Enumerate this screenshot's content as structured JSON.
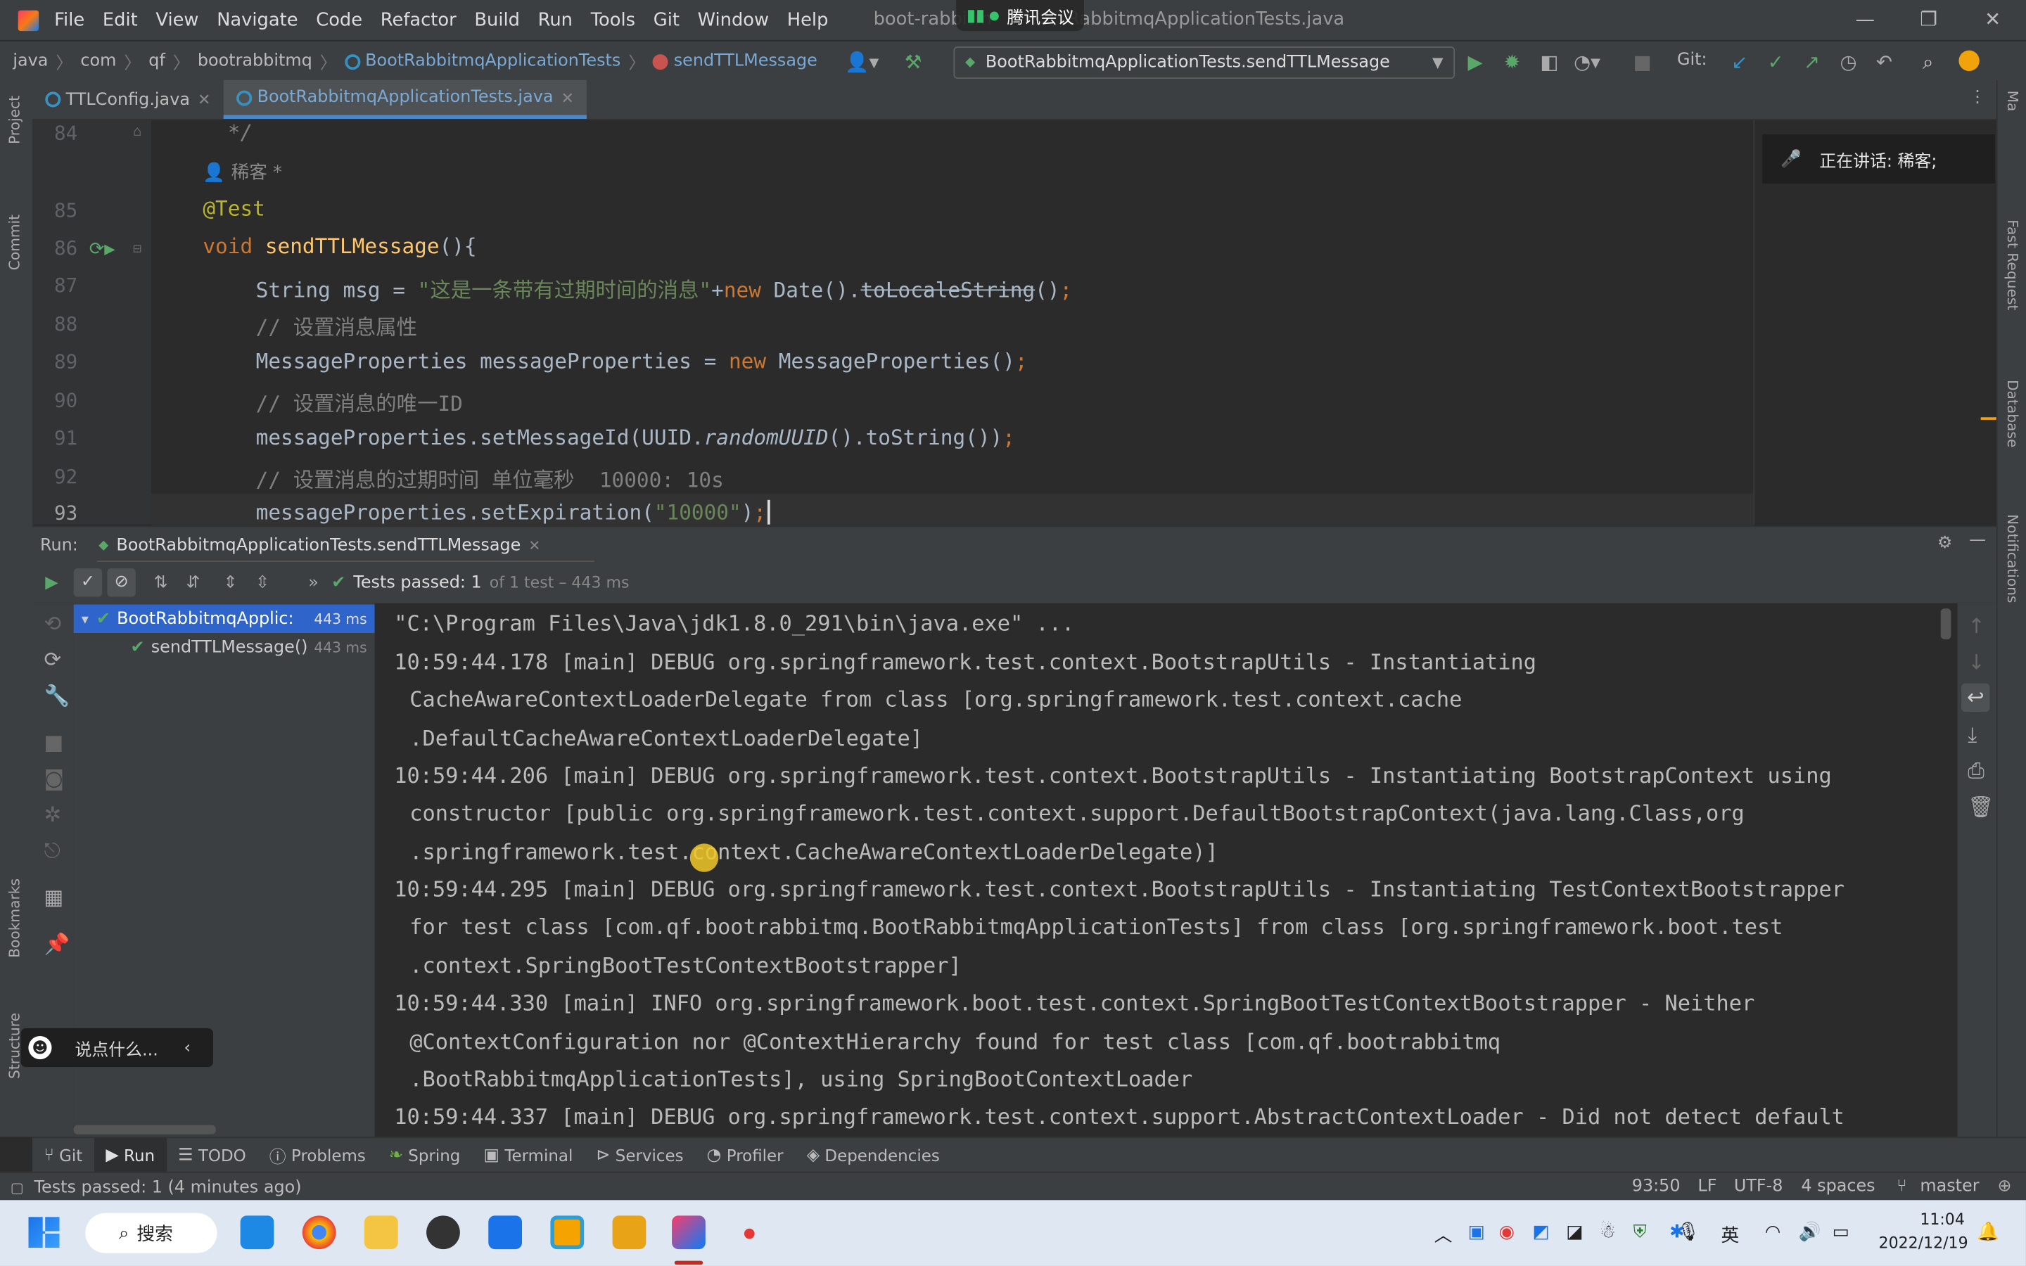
{
  "window": {
    "menu": [
      "File",
      "Edit",
      "View",
      "Navigate",
      "Code",
      "Refactor",
      "Build",
      "Run",
      "Tools",
      "Git",
      "Window",
      "Help"
    ],
    "title_left": "boot-rabbitm",
    "title_right": "RabbitmqApplicationTests.java"
  },
  "meeting": {
    "app_name": "腾讯会议",
    "speaking_text": "正在讲话: 稀客;",
    "chat_placeholder": "说点什么..."
  },
  "navbar": {
    "crumbs": [
      "java",
      "com",
      "qf",
      "bootrabbitmq",
      "BootRabbitmqApplicationTests",
      "sendTTLMessage"
    ],
    "run_config": "BootRabbitmqApplicationTests.sendTTLMessage",
    "git_label": "Git:"
  },
  "tabs": [
    {
      "label": "TTLConfig.java"
    },
    {
      "label": "BootRabbitmqApplicationTests.java"
    }
  ],
  "left_stripe": [
    "Project",
    "Commit",
    "Bookmarks",
    "Structure"
  ],
  "right_stripe": [
    "Ma",
    "Fast Request",
    "Database",
    "Notifications"
  ],
  "editor": {
    "lines": [
      {
        "num": "84",
        "code": "  */"
      },
      {
        "num": "",
        "code": "稀客 *"
      },
      {
        "num": "85",
        "code": "@Test"
      },
      {
        "num": "86",
        "code": "void sendTTLMessage(){"
      },
      {
        "num": "87",
        "code": "String msg = \"这是一条带有过期时间的消息\"+new Date().toLocaleString();"
      },
      {
        "num": "88",
        "code": "// 设置消息属性"
      },
      {
        "num": "89",
        "code": "MessageProperties messageProperties = new MessageProperties();"
      },
      {
        "num": "90",
        "code": "// 设置消息的唯一ID"
      },
      {
        "num": "91",
        "code": "messageProperties.setMessageId(UUID.randomUUID().toString());"
      },
      {
        "num": "92",
        "code": "// 设置消息的过期时间 单位毫秒  10000: 10s"
      },
      {
        "num": "93",
        "code": "messageProperties.setExpiration(\"10000\");"
      }
    ]
  },
  "run": {
    "label": "Run:",
    "tab": "BootRabbitmqApplicationTests.sendTTLMessage",
    "tests_passed": "Tests passed: 1",
    "tests_detail": "of 1 test – 443 ms",
    "tree": [
      {
        "label": "BootRabbitmqApplic:",
        "time": "443 ms"
      },
      {
        "label": "sendTTLMessage()",
        "time": "443 ms"
      }
    ],
    "console": [
      "\"C:\\Program Files\\Java\\jdk1.8.0_291\\bin\\java.exe\" ...",
      "10:59:44.178 [main] DEBUG org.springframework.test.context.BootstrapUtils - Instantiating",
      "CacheAwareContextLoaderDelegate from class [org.springframework.test.context.cache",
      ".DefaultCacheAwareContextLoaderDelegate]",
      "10:59:44.206 [main] DEBUG org.springframework.test.context.BootstrapUtils - Instantiating BootstrapContext using",
      "constructor [public org.springframework.test.context.support.DefaultBootstrapContext(java.lang.Class,org",
      ".springframework.test.context.CacheAwareContextLoaderDelegate)]",
      "10:59:44.295 [main] DEBUG org.springframework.test.context.BootstrapUtils - Instantiating TestContextBootstrapper",
      "for test class [com.qf.bootrabbitmq.BootRabbitmqApplicationTests] from class [org.springframework.boot.test",
      ".context.SpringBootTestContextBootstrapper]",
      "10:59:44.330 [main] INFO org.springframework.boot.test.context.SpringBootTestContextBootstrapper - Neither",
      "@ContextConfiguration nor @ContextHierarchy found for test class [com.qf.bootrabbitmq",
      ".BootRabbitmqApplicationTests], using SpringBootContextLoader",
      "10:59:44.337 [main] DEBUG org.springframework.test.context.support.AbstractContextLoader - Did not detect default"
    ]
  },
  "bottom_tabs": [
    "Git",
    "Run",
    "TODO",
    "Problems",
    "Spring",
    "Terminal",
    "Services",
    "Profiler",
    "Dependencies"
  ],
  "status": {
    "left": "Tests passed: 1 (4 minutes ago)",
    "position": "93:50",
    "line_sep": "LF",
    "encoding": "UTF-8",
    "indent": "4 spaces",
    "branch": "master"
  },
  "taskbar": {
    "search": "搜索",
    "ime": "英",
    "time": "11:04",
    "date": "2022/12/19"
  },
  "colors": {
    "accent": "#4a88c7",
    "success": "#59a869",
    "keyword": "#cc7832",
    "string": "#6a8759",
    "comment": "#808080"
  }
}
